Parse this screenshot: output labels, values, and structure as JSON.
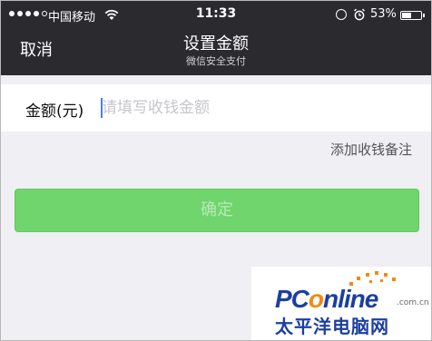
{
  "status_bar": {
    "carrier": "中国移动",
    "time": "11:33",
    "battery_percent": "53%",
    "battery_level": 0.53,
    "signal_bars_filled": 4,
    "signal_bars_total": 5
  },
  "header": {
    "cancel_label": "取消",
    "title": "设置金额",
    "subtitle": "微信安全支付"
  },
  "amount": {
    "label": "金额(元)",
    "placeholder": "请填写收钱金额",
    "value": ""
  },
  "add_note_label": "添加收钱备注",
  "confirm_label": "确定",
  "colors": {
    "header_bg": "#2b2a2f",
    "page_bg": "#efeff4",
    "button_green": "#6fd56c",
    "watermark_blue": "#1b3fa0",
    "watermark_orange": "#f28a12"
  },
  "watermark": {
    "logo_pc": "PC",
    "logo_o": "o",
    "logo_rest": "nline",
    "dotcom": ".com.cn",
    "chinese": "太平洋电脑网"
  }
}
